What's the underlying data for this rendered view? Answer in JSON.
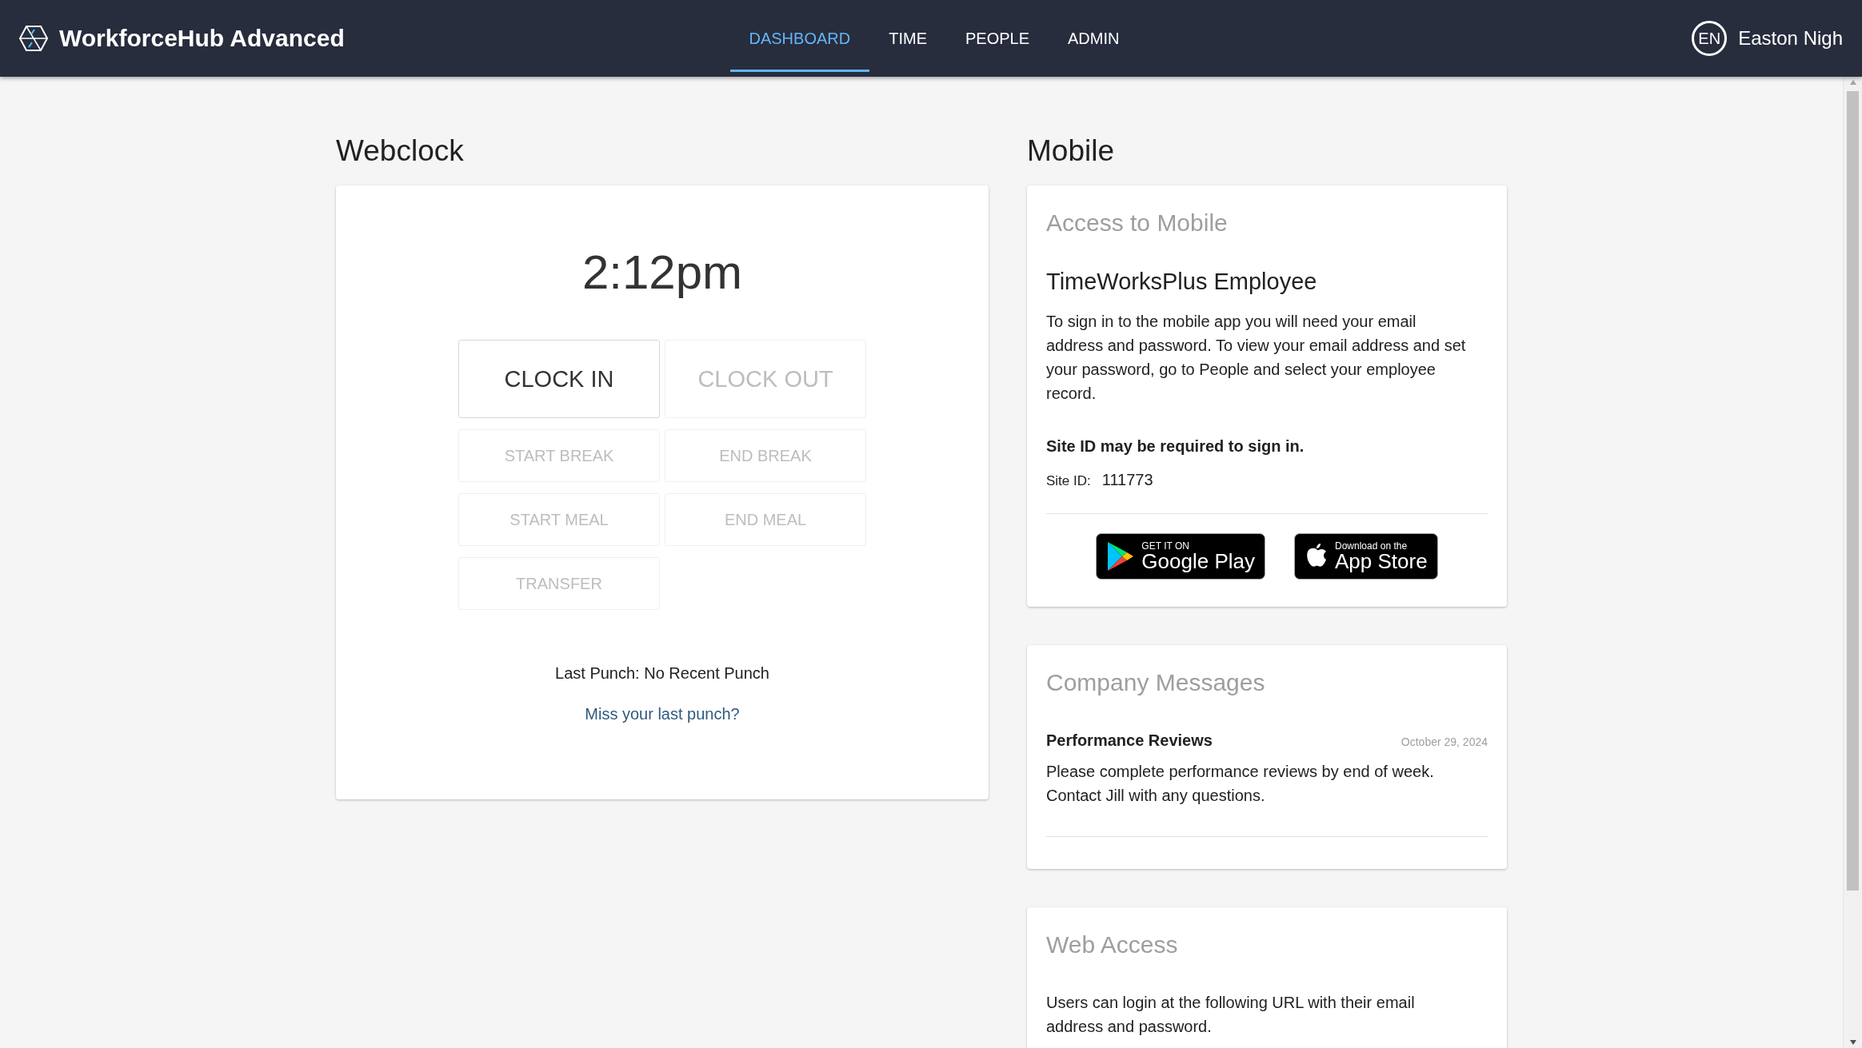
{
  "header": {
    "brand": "WorkforceHub Advanced",
    "nav": [
      {
        "label": "DASHBOARD",
        "selected": true
      },
      {
        "label": "TIME",
        "selected": false
      },
      {
        "label": "PEOPLE",
        "selected": false
      },
      {
        "label": "ADMIN",
        "selected": false
      }
    ],
    "user": {
      "initials": "EN",
      "name": "Easton Nigh"
    }
  },
  "webclock": {
    "title": "Webclock",
    "time": "2:12pm",
    "buttons": [
      {
        "label": "CLOCK IN",
        "kind": "large",
        "disabled": false
      },
      {
        "label": "CLOCK OUT",
        "kind": "large",
        "disabled": true
      },
      {
        "label": "START BREAK",
        "kind": "small",
        "disabled": true
      },
      {
        "label": "END BREAK",
        "kind": "small",
        "disabled": true
      },
      {
        "label": "START MEAL",
        "kind": "small",
        "disabled": true
      },
      {
        "label": "END MEAL",
        "kind": "small",
        "disabled": true
      },
      {
        "label": "TRANSFER",
        "kind": "small",
        "disabled": true
      }
    ],
    "last_punch": "Last Punch: No Recent Punch",
    "missed_link": "Miss your last punch?"
  },
  "mobile": {
    "title": "Mobile",
    "card_title": "Access to Mobile",
    "app_name": "TimeWorksPlus Employee",
    "description": "To sign in to the mobile app you will need your email address and password. To view your email address and set your password, go to People and select your employee record.",
    "site_note": "Site ID may be required to sign in.",
    "site_id_label": "Site ID:",
    "site_id": "111773",
    "badges": [
      {
        "kind": "google",
        "small": "GET IT ON",
        "big": "Google Play"
      },
      {
        "kind": "apple",
        "small": "Download on the",
        "big": "App Store"
      }
    ]
  },
  "company_messages": {
    "title": "Company Messages",
    "messages": [
      {
        "title": "Performance Reviews",
        "date": "October 29, 2024",
        "body": "Please complete performance reviews by end of week. Contact Jill with any questions."
      }
    ]
  },
  "web_access": {
    "title": "Web Access",
    "body": "Users can login at the following URL with their email address and password."
  }
}
